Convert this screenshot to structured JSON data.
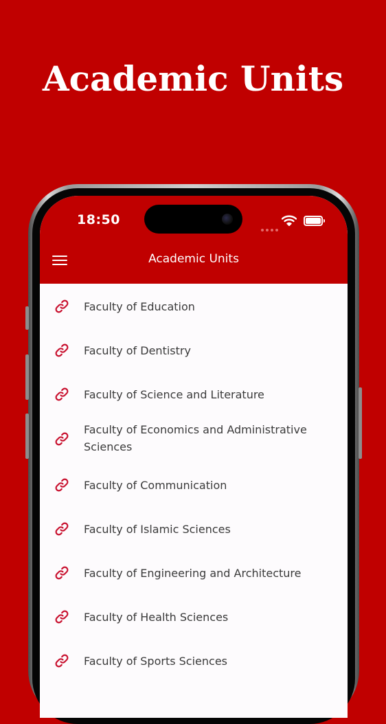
{
  "promo": {
    "title": "Academic Units"
  },
  "status_bar": {
    "time": "18:50"
  },
  "app_bar": {
    "title": "Academic Units",
    "menu_icon": "hamburger-menu-icon"
  },
  "list": {
    "item_icon": "link-icon",
    "items": [
      {
        "label": "Faculty of Education"
      },
      {
        "label": "Faculty of Dentistry"
      },
      {
        "label": "Faculty of Science and Literature"
      },
      {
        "label": "Faculty of Economics and Administrative Sciences"
      },
      {
        "label": "Faculty of Communication"
      },
      {
        "label": "Faculty of Islamic Sciences"
      },
      {
        "label": "Faculty of Engineering and Architecture"
      },
      {
        "label": "Faculty of Health Sciences"
      },
      {
        "label": "Faculty of Sports Sciences"
      }
    ]
  },
  "colors": {
    "brand_red": "#c00000",
    "list_background": "#fdfbfd",
    "text": "#3a3a3a"
  }
}
